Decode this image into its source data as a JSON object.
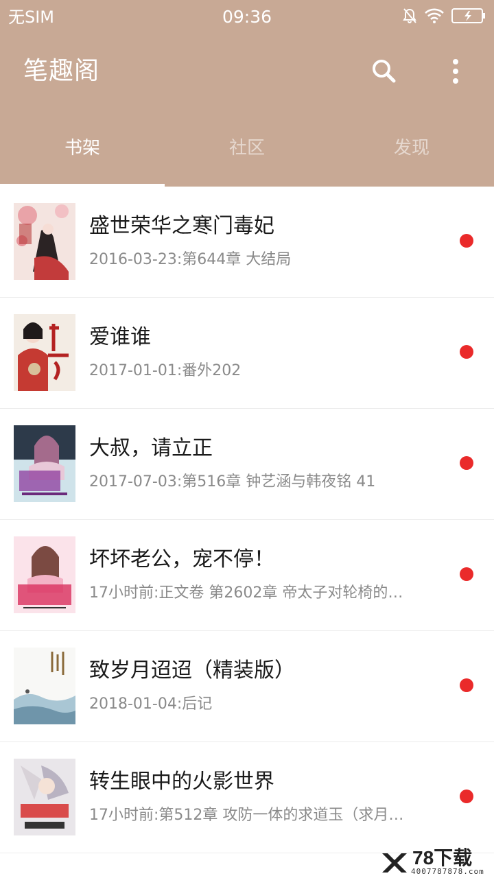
{
  "status_bar": {
    "carrier": "无SIM",
    "time": "09:36",
    "icons": [
      "silent-icon",
      "wifi-icon",
      "battery-charging-icon"
    ]
  },
  "toolbar": {
    "title": "笔趣阁",
    "search_icon": "search-icon",
    "more_icon": "more-vertical-icon"
  },
  "tabs": [
    {
      "label": "书架",
      "active": true
    },
    {
      "label": "社区",
      "active": false
    },
    {
      "label": "发现",
      "active": false
    }
  ],
  "books": [
    {
      "title": "盛世荣华之寒门毒妃",
      "update": "2016-03-23:第644章 大结局",
      "unread": true
    },
    {
      "title": "爱谁谁",
      "update": "2017-01-01:番外202",
      "unread": true
    },
    {
      "title": "大叔，请立正",
      "update": "2017-07-03:第516章 钟艺涵与韩夜铭 41",
      "unread": true
    },
    {
      "title": "坏坏老公，宠不停！",
      "update": "17小时前:正文卷 第2602章 帝太子对轮椅的…",
      "unread": true
    },
    {
      "title": "致岁月迢迢（精装版）",
      "update": "2018-01-04:后记",
      "unread": true
    },
    {
      "title": "转生眼中的火影世界",
      "update": "17小时前:第512章 攻防一体的求道玉（求月…",
      "unread": true
    }
  ],
  "watermark": {
    "brand": "78下载",
    "phone": "4007787878.com"
  },
  "colors": {
    "header": "#c8a995",
    "unread_dot": "#ea2a2a",
    "title_text": "#1a1a1a",
    "meta_text": "#8a8a8a"
  }
}
